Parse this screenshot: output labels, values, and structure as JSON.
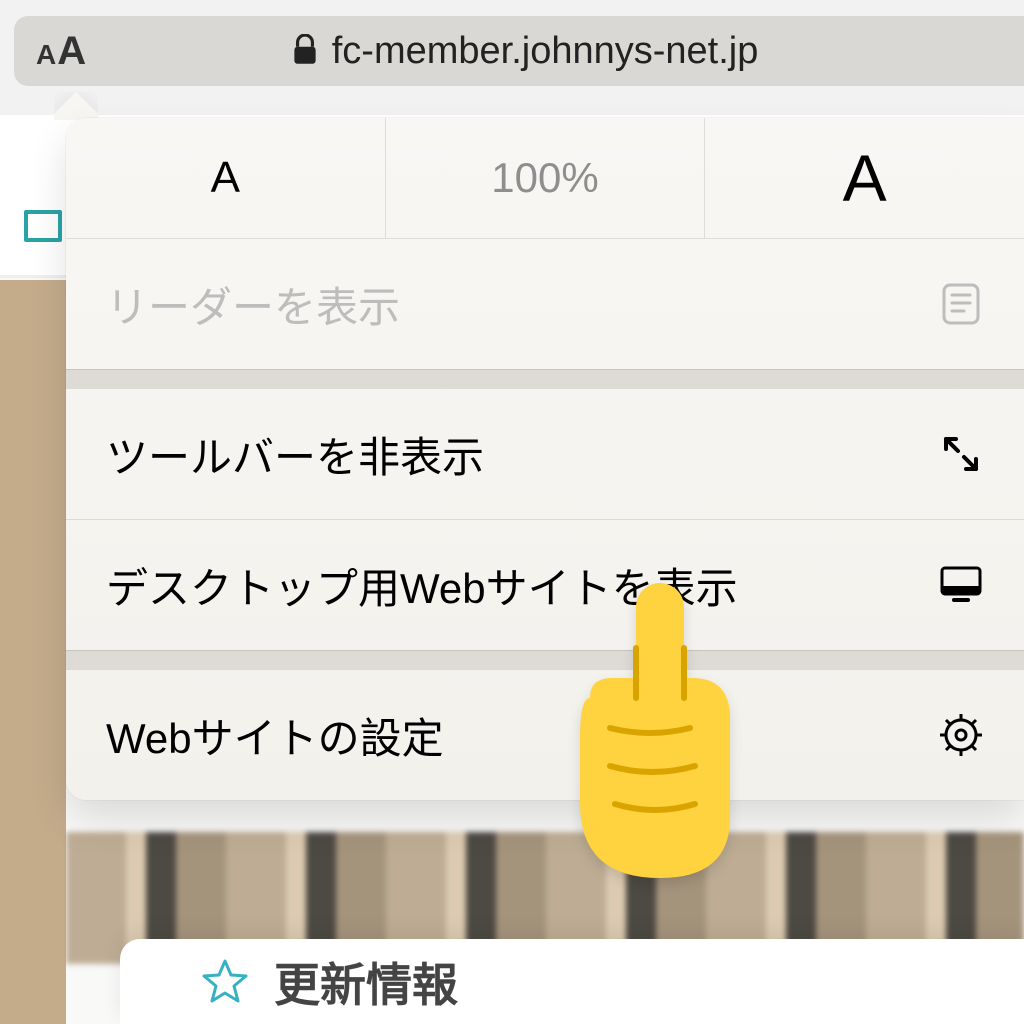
{
  "address_bar": {
    "domain": "fc-member.johnnys-net.jp"
  },
  "popover": {
    "zoom_percent": "100%",
    "items": {
      "show_reader": "リーダーを表示",
      "hide_toolbar": "ツールバーを非表示",
      "request_desktop": "デスクトップ用Webサイトを表示",
      "website_settings": "Webサイトの設定"
    }
  },
  "bottom_card": {
    "label": "更新情報"
  }
}
